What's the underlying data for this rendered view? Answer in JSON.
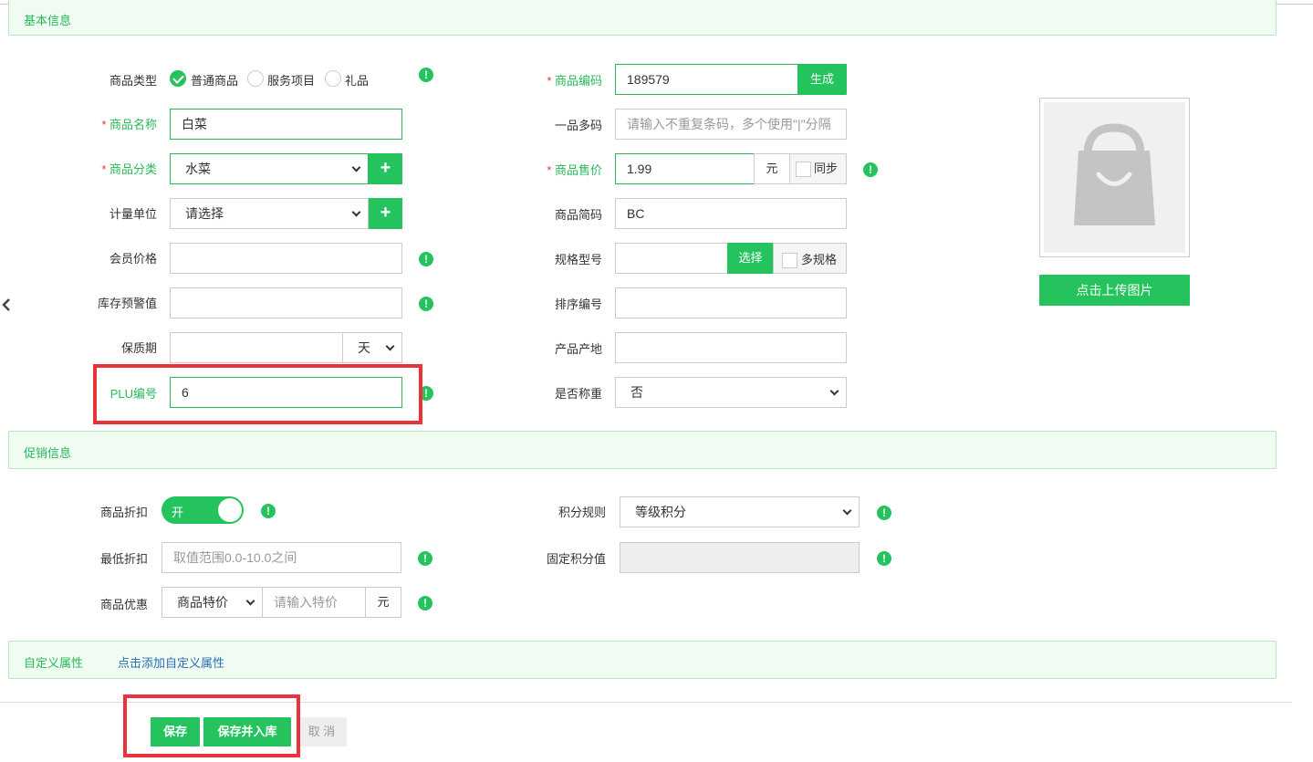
{
  "sections": {
    "basic": "基本信息",
    "promo": "促销信息",
    "custom": "自定义属性",
    "custom_link": "点击添加自定义属性"
  },
  "form": {
    "type_label": "商品类型",
    "type_options": [
      "普通商品",
      "服务项目",
      "礼品"
    ],
    "name_label": "商品名称",
    "name_value": "白菜",
    "category_label": "商品分类",
    "category_value": "水菜",
    "unit_label": "计量单位",
    "unit_value": "请选择",
    "member_price_label": "会员价格",
    "stock_alert_label": "库存预警值",
    "shelf_life_label": "保质期",
    "shelf_unit": "天",
    "plu_label": "PLU编号",
    "plu_value": "6",
    "code_label": "商品编码",
    "code_value": "189579",
    "generate_btn": "生成",
    "multicode_label": "一品多码",
    "multicode_placeholder": "请输入不重复条码，多个使用\"|\"分隔",
    "price_label": "商品售价",
    "price_value": "1.99",
    "price_unit": "元",
    "sync_label": "同步",
    "short_code_label": "商品简码",
    "short_code_value": "BC",
    "spec_label": "规格型号",
    "spec_select_btn": "选择",
    "multi_spec_label": "多规格",
    "sort_label": "排序编号",
    "origin_label": "产品产地",
    "weigh_label": "是否称重",
    "weigh_value": "否",
    "upload_btn": "点击上传图片"
  },
  "promo": {
    "discount_label": "商品折扣",
    "discount_toggle": "开",
    "min_discount_label": "最低折扣",
    "min_discount_placeholder": "取值范围0.0-10.0之间",
    "offer_label": "商品优惠",
    "offer_type": "商品特价",
    "offer_placeholder": "请输入特价",
    "offer_unit": "元",
    "points_rule_label": "积分规则",
    "points_rule_value": "等级积分",
    "fixed_points_label": "固定积分值"
  },
  "actions": {
    "save": "保存",
    "save_stock": "保存并入库",
    "cancel": "取 消"
  },
  "colors": {
    "accent": "#25c35e",
    "required": "#e53935",
    "highlight_box": "#e8333a"
  }
}
